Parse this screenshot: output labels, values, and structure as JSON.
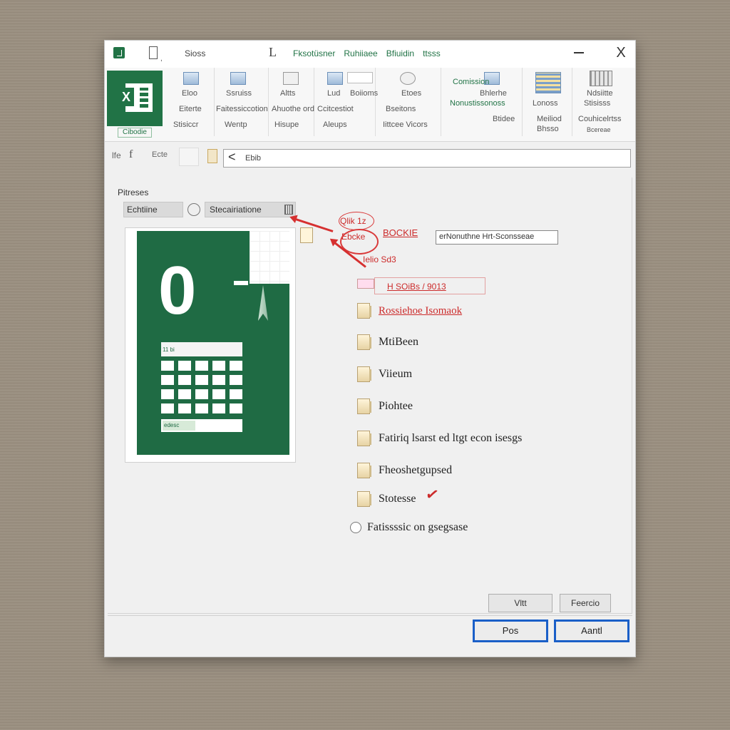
{
  "titlebar": {
    "save_label": "Sioss",
    "l_label": "L",
    "tabs": [
      "Fksotüsner",
      "Ruhiiaee",
      "Bfiuidin",
      "ttsss"
    ],
    "minimize_label": "minimize",
    "close_label": "X"
  },
  "ribbon": {
    "logo_label": "Cibodie",
    "groups": [
      {
        "top": "Eloo",
        "mid": "Eiterte",
        "bot": "Stisiccr"
      },
      {
        "top": "Ssruiss",
        "mid": "Faitessiccotion",
        "bot": "Wentp"
      },
      {
        "top": "Altts",
        "mid": "Ahuothe ord",
        "bot": "Hisupe"
      },
      {
        "top": "Lud",
        "mid": "Ccitcestiot",
        "bot": "Aleups",
        "extra": "Boiioms"
      },
      {
        "top": "Etoes",
        "mid": "Bseitons",
        "bot": "Iittcee Vicors"
      },
      {
        "top": "Comission",
        "mid": "Nonustissonoss",
        "bot": "Btidee",
        "extra": "Bhlerhe"
      },
      {
        "top": "Lonoss",
        "mid": "Meiliod",
        "bot": "Bhsso"
      },
      {
        "top": "Ndsiitte",
        "mid": "Stisisss",
        "bot": "Couhicelrtss",
        "extra": "Bcereae"
      }
    ]
  },
  "formula_bar": {
    "left_label": "lfe",
    "fx": "f",
    "name_label": "Ecte",
    "back": "<",
    "value": "Ebib"
  },
  "pane": {
    "title": "Pitreses",
    "tab1": "Echtiine",
    "tab2": "Stecairiatione",
    "preview_number": "0",
    "preview_head_label": "11 bi",
    "preview_foot_label": "edesc"
  },
  "annotations": {
    "top_label": "Qlik 1z",
    "top_sub": "Ebcke",
    "head_label": "BOCKIE",
    "head_input": "erNonuthne Hrt-Sconsseae",
    "mid_label": "Ielio Sd3",
    "mid_text": "H SOiBs / 9013"
  },
  "options": [
    {
      "label": "Rossiehoe Isomaok",
      "style": "red"
    },
    {
      "label": "MtiBeen",
      "style": "normal"
    },
    {
      "label": "Viieum",
      "style": "normal"
    },
    {
      "label": "Piohtee",
      "style": "normal"
    },
    {
      "label": "Fatiriq lsarst ed ltgt econ isesgs",
      "style": "normal"
    },
    {
      "label": "Fheoshetgupsed",
      "style": "normal"
    },
    {
      "label": "Stotesse",
      "style": "normal"
    },
    {
      "label": "Fatissssic on gsegsase",
      "style": "radio"
    }
  ],
  "buttons": {
    "mid_left": "Vltt",
    "mid_right": "Feercio",
    "foot_left": "Pos",
    "foot_right": "Aantl"
  },
  "colors": {
    "excel_green": "#217346",
    "annotation_red": "#cc2b2b",
    "focus_blue": "#1a5fc8"
  }
}
